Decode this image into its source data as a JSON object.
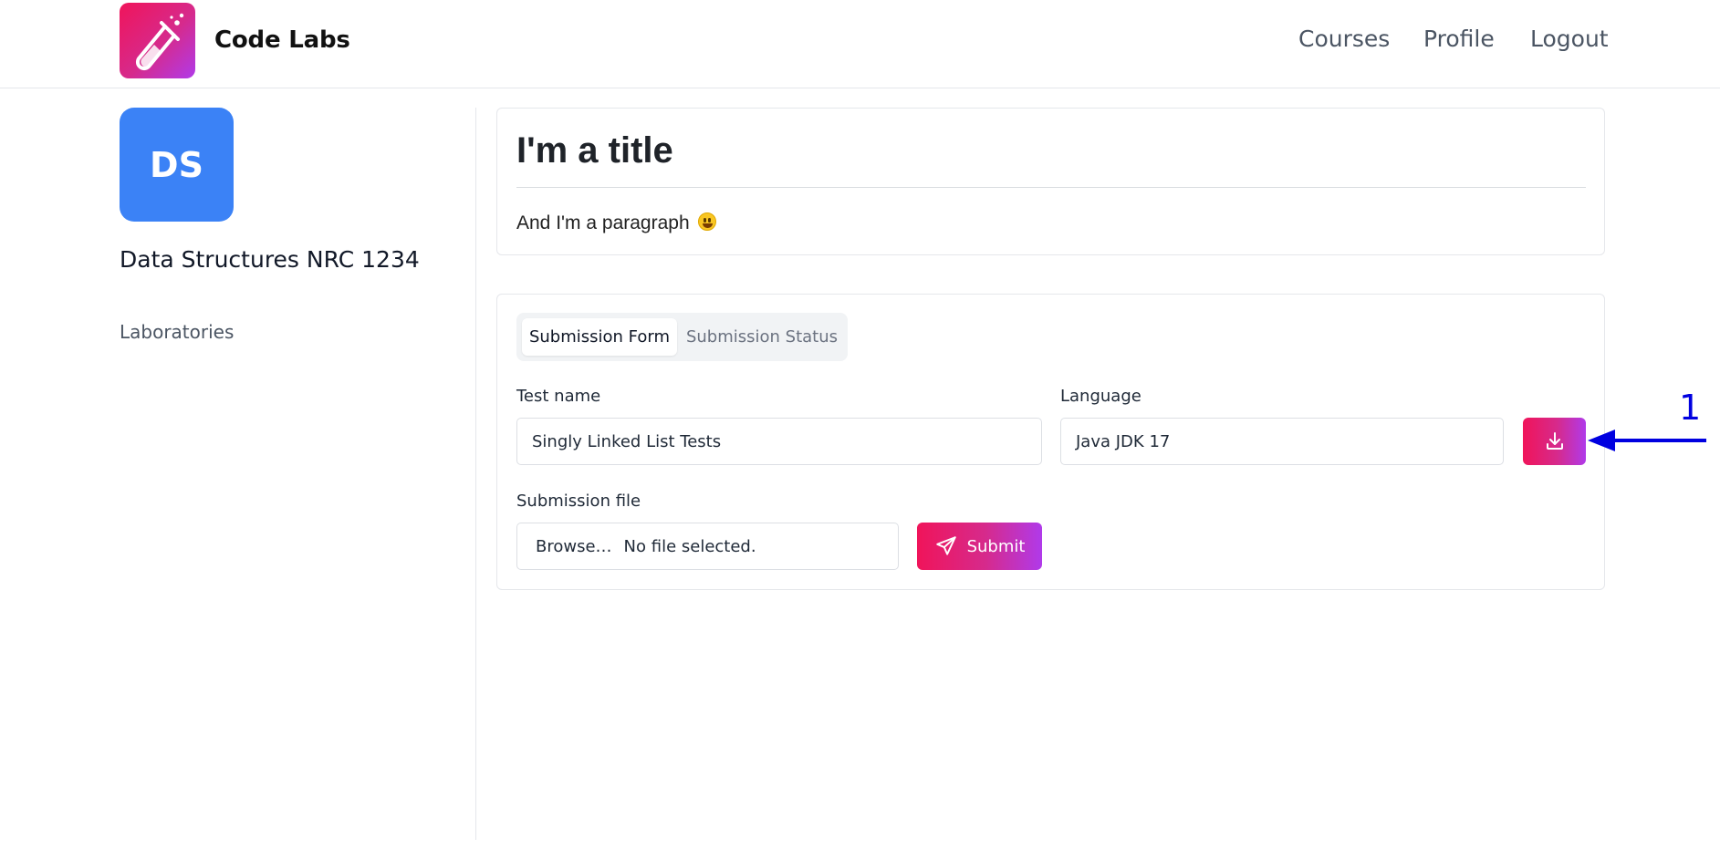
{
  "header": {
    "brand": "Code Labs",
    "logo_icon": "test-tube-icon",
    "nav": [
      "Courses",
      "Profile",
      "Logout"
    ]
  },
  "sidebar": {
    "avatar_initials": "DS",
    "avatar_color": "#3b82f6",
    "course_name": "Data Structures NRC 1234",
    "links": [
      "Laboratories"
    ]
  },
  "intro": {
    "title": "I'm a title",
    "paragraph": "And I'm a paragraph",
    "emoji_icon": "grinning-face-icon"
  },
  "form": {
    "tabs": [
      {
        "label": "Submission Form",
        "active": true
      },
      {
        "label": "Submission Status",
        "active": false
      }
    ],
    "test_name_label": "Test name",
    "test_name_value": "Singly Linked List Tests",
    "language_label": "Language",
    "language_value": "Java JDK 17",
    "download_icon": "download-icon",
    "file_label": "Submission file",
    "browse_label": "Browse…",
    "file_status": "No file selected.",
    "submit_label": "Submit",
    "submit_icon": "send-icon"
  },
  "annotation": {
    "number": "1",
    "color": "#0000e0"
  },
  "colors": {
    "brand_gradient_start": "#f0145a",
    "brand_gradient_end": "#b03aea"
  }
}
